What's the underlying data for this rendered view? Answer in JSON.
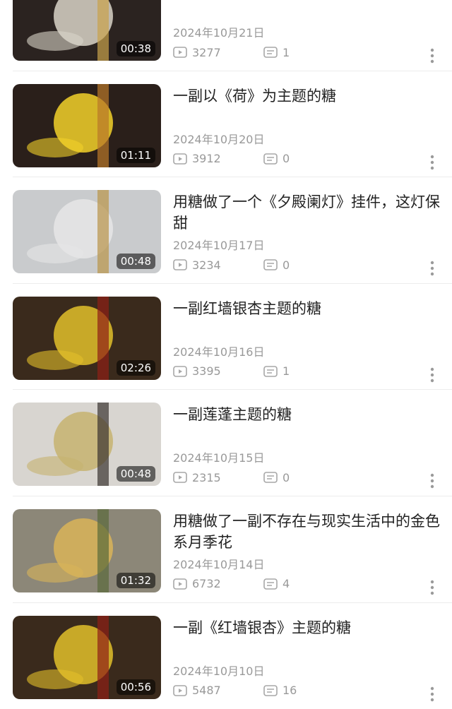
{
  "videos": [
    {
      "title": "",
      "date": "2024年10月21日",
      "plays": "3277",
      "comments": "1",
      "duration": "00:38",
      "thumb_colors": [
        "#2b2320",
        "#d9d3c8",
        "#c9a24b"
      ]
    },
    {
      "title": "一副以《荷》为主题的糖",
      "date": "2024年10月20日",
      "plays": "3912",
      "comments": "0",
      "duration": "01:11",
      "thumb_colors": [
        "#2a1f1a",
        "#f2d12a",
        "#b9772a"
      ]
    },
    {
      "title": "用糖做了一个《夕殿阑灯》挂件，这灯保甜",
      "date": "2024年10月17日",
      "plays": "3234",
      "comments": "0",
      "duration": "00:48",
      "thumb_colors": [
        "#c9cbcd",
        "#e6e6e6",
        "#b99448"
      ]
    },
    {
      "title": "一副红墙银杏主题的糖",
      "date": "2024年10月16日",
      "plays": "3395",
      "comments": "1",
      "duration": "02:26",
      "thumb_colors": [
        "#3a2a1c",
        "#e2c02a",
        "#8e1f16"
      ]
    },
    {
      "title": "一副莲蓬主题的糖",
      "date": "2024年10月15日",
      "plays": "2315",
      "comments": "0",
      "duration": "00:48",
      "thumb_colors": [
        "#d8d5d0",
        "#c7b370",
        "#3a3330"
      ]
    },
    {
      "title": "用糖做了一副不存在与现实生活中的金色系月季花",
      "date": "2024年10月14日",
      "plays": "6732",
      "comments": "4",
      "duration": "01:32",
      "thumb_colors": [
        "#8c8778",
        "#d9b458",
        "#5a6a3a"
      ]
    },
    {
      "title": "一副《红墙银杏》主题的糖",
      "date": "2024年10月10日",
      "plays": "5487",
      "comments": "16",
      "duration": "00:56",
      "thumb_colors": [
        "#3a2a1c",
        "#e2c02a",
        "#8e1f16"
      ]
    }
  ],
  "icons": {
    "plays": "play-count-icon",
    "comments": "comment-count-icon",
    "more": "more-vertical-icon"
  },
  "colors": {
    "meta_text": "#999999",
    "title_text": "#222222",
    "divider": "#ececec"
  }
}
